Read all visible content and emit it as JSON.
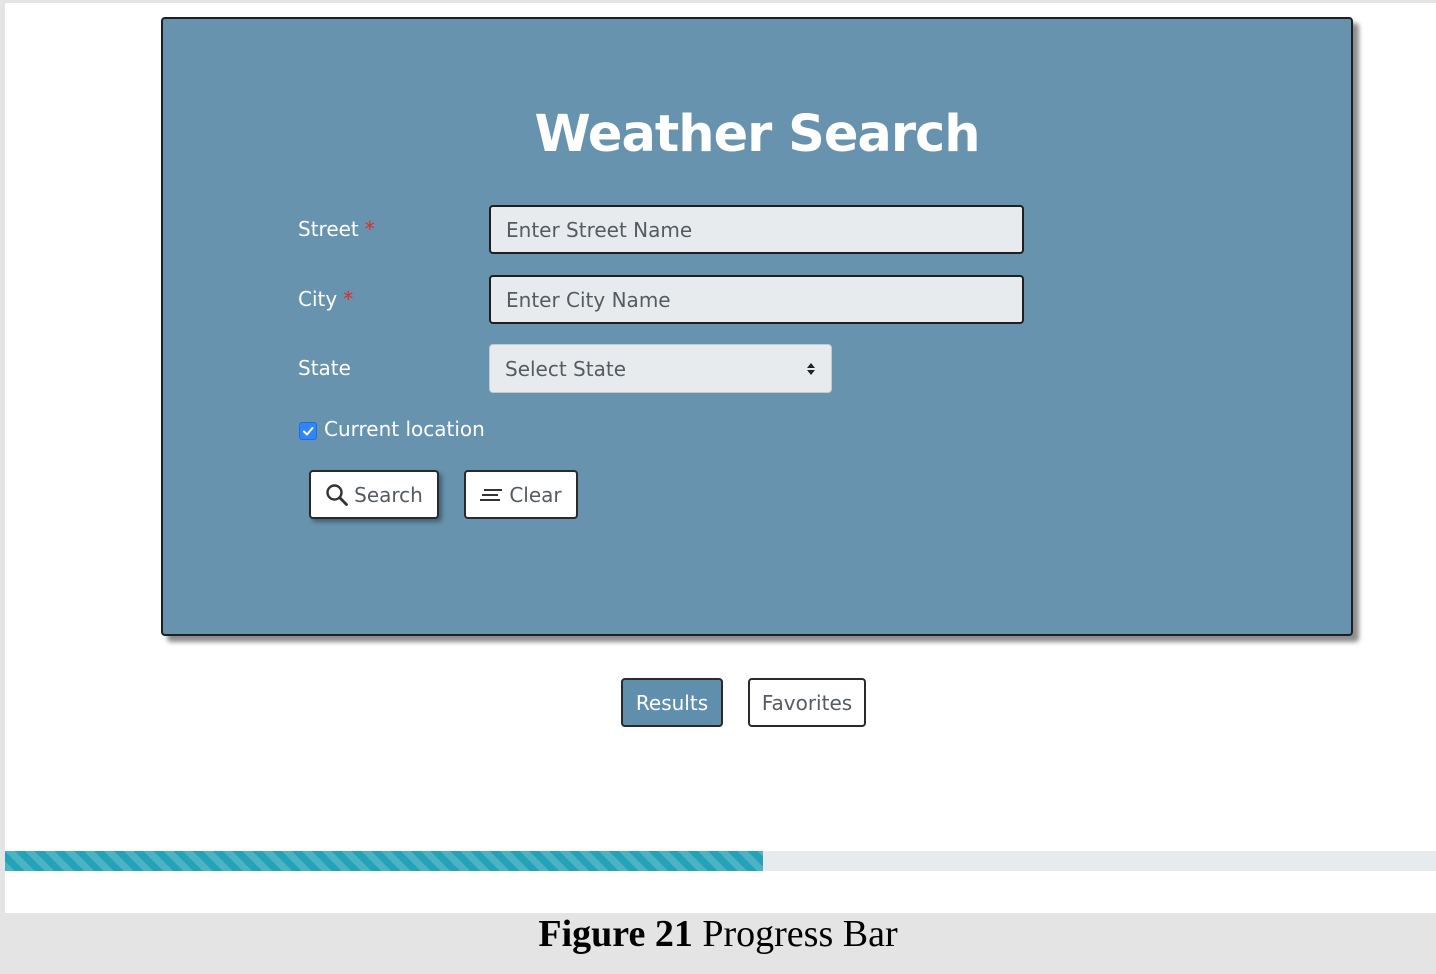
{
  "form": {
    "title": "Weather Search",
    "street": {
      "label": "Street",
      "required_mark": "*",
      "placeholder": "Enter Street Name"
    },
    "city": {
      "label": "City",
      "required_mark": "*",
      "placeholder": "Enter City Name"
    },
    "state": {
      "label": "State",
      "selected": "Select State"
    },
    "current_location": {
      "label": "Current location",
      "checked": true
    },
    "search_button": {
      "label": "Search",
      "icon": "search-icon"
    },
    "clear_button": {
      "label": "Clear",
      "icon": "clear-format-icon"
    }
  },
  "tabs": {
    "results": "Results",
    "favorites": "Favorites"
  },
  "progress": {
    "value_percent": 53
  },
  "caption": {
    "figure": "Figure 21",
    "text": "Progress Bar"
  },
  "colors": {
    "card_bg": "#6793ae",
    "results_tab_bg": "#5f8fad",
    "progress_fill": "#25a2b8",
    "required": "#e02b2b",
    "checkbox": "#2f86f6"
  }
}
